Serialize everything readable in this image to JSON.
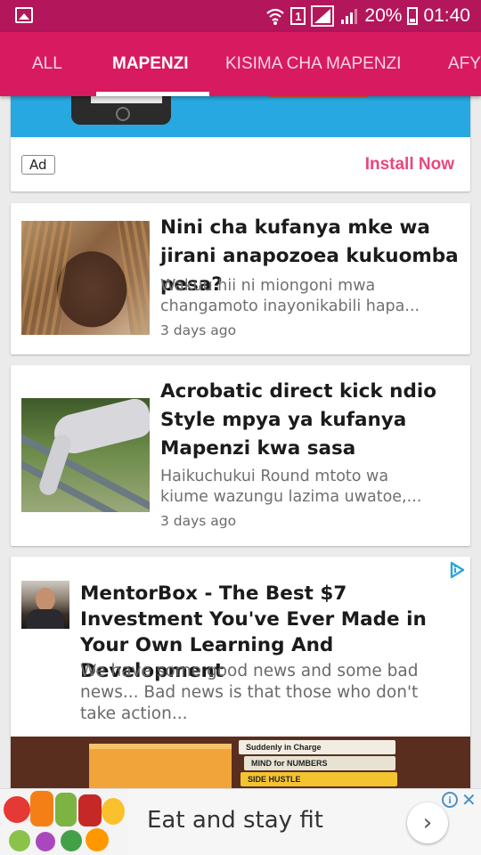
{
  "status_bar": {
    "battery": "20%",
    "time": "01:40",
    "sim": "1"
  },
  "tabs": [
    {
      "label": "ALL"
    },
    {
      "label": "MAPENZI"
    },
    {
      "label": "KISIMA CHA MAPENZI"
    },
    {
      "label": "AFY"
    }
  ],
  "ad_card": {
    "ad_label": "Ad",
    "cta": "Install Now"
  },
  "articles": [
    {
      "title": "Nini cha kufanya mke wa jirani anapozoea kukuomba pesa?",
      "excerpt": "Wakuu hii ni miongoni mwa\nchangamoto inayonikabili hapa...",
      "time": "3 days ago"
    },
    {
      "title": "Acrobatic direct kick ndio Style mpya ya kufanya Mapenzi kwa sasa",
      "excerpt": "Haikuchukui Round mtoto wa\nkiume wazungu lazima uwatoe,...",
      "time": "3 days ago"
    }
  ],
  "promo": {
    "title": "MentorBox - The Best $7 Investment You've Ever Made in Your Own Learning And Development",
    "description": "We have some good news and some bad\nnews...  Bad news is that those who don't\ntake action...",
    "books": [
      "Suddenly in Charge",
      "MIND for NUMBERS",
      "SIDE HUSTLE",
      ""
    ]
  },
  "bottom_ad": {
    "text": "Eat and stay fit"
  },
  "colors": {
    "status_bar": "#b3165a",
    "tab_bar": "#d81b60",
    "install_cta": "#e8477c",
    "ad_banner": "#27a8e0"
  }
}
